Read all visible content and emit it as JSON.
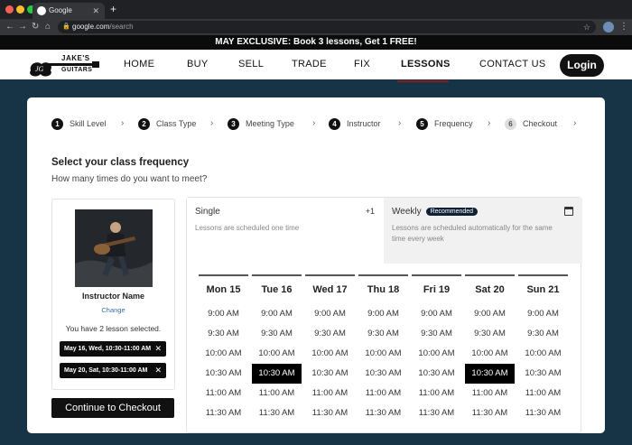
{
  "browser": {
    "tab_title": "Google",
    "tab_close": "✕",
    "new_tab": "+",
    "url_domain": "google.com",
    "url_path": "/search"
  },
  "promo": "MAY EXCLUSIVE: Book 3 lessons, Get 1 FREE!",
  "logo": {
    "line1": "JAKE'S",
    "line2": "GUITARS"
  },
  "nav": [
    "HOME",
    "BUY",
    "SELL",
    "TRADE",
    "FIX",
    "LESSONS",
    "CONTACT US"
  ],
  "active_nav": "LESSONS",
  "login": "Login",
  "steps": [
    {
      "n": "1",
      "label": "Skill Level"
    },
    {
      "n": "2",
      "label": "Class Type"
    },
    {
      "n": "3",
      "label": "Meeting Type"
    },
    {
      "n": "4",
      "label": "Instructor"
    },
    {
      "n": "5",
      "label": "Frequency"
    },
    {
      "n": "6",
      "label": "Checkout"
    }
  ],
  "heading": "Select your class frequency",
  "subheading": "How many times do you want to meet?",
  "instructor": {
    "name": "Instructor Name",
    "change": "Change",
    "count_text": "You have 2 lesson selected.",
    "selections": [
      "May 16, Wed, 10:30-11:00 AM",
      "May 20, Sat, 10:30-11:00 AM"
    ]
  },
  "checkout_button": "Continue to Checkout",
  "options": {
    "single": {
      "title": "Single",
      "desc": "Lessons are scheduled one time",
      "badge": "+1"
    },
    "weekly": {
      "title": "Weekly",
      "badge": "Recommended",
      "desc": "Lessons are scheduled automatically for the same time every week"
    }
  },
  "schedule": {
    "days": [
      "Mon 15",
      "Tue 16",
      "Wed 17",
      "Thu 18",
      "Fri 19",
      "Sat 20",
      "Sun 21"
    ],
    "times": [
      "9:00 AM",
      "9:30 AM",
      "10:00 AM",
      "10:30 AM",
      "11:00 AM",
      "11:30 AM"
    ],
    "selected": [
      {
        "day": "Tue 16",
        "time": "10:30 AM"
      },
      {
        "day": "Sat 20",
        "time": "10:30 AM"
      }
    ]
  },
  "colors": {
    "page_bg": "#173447",
    "accent_underline": "#8b1a1a",
    "badge": "#0e2033"
  }
}
